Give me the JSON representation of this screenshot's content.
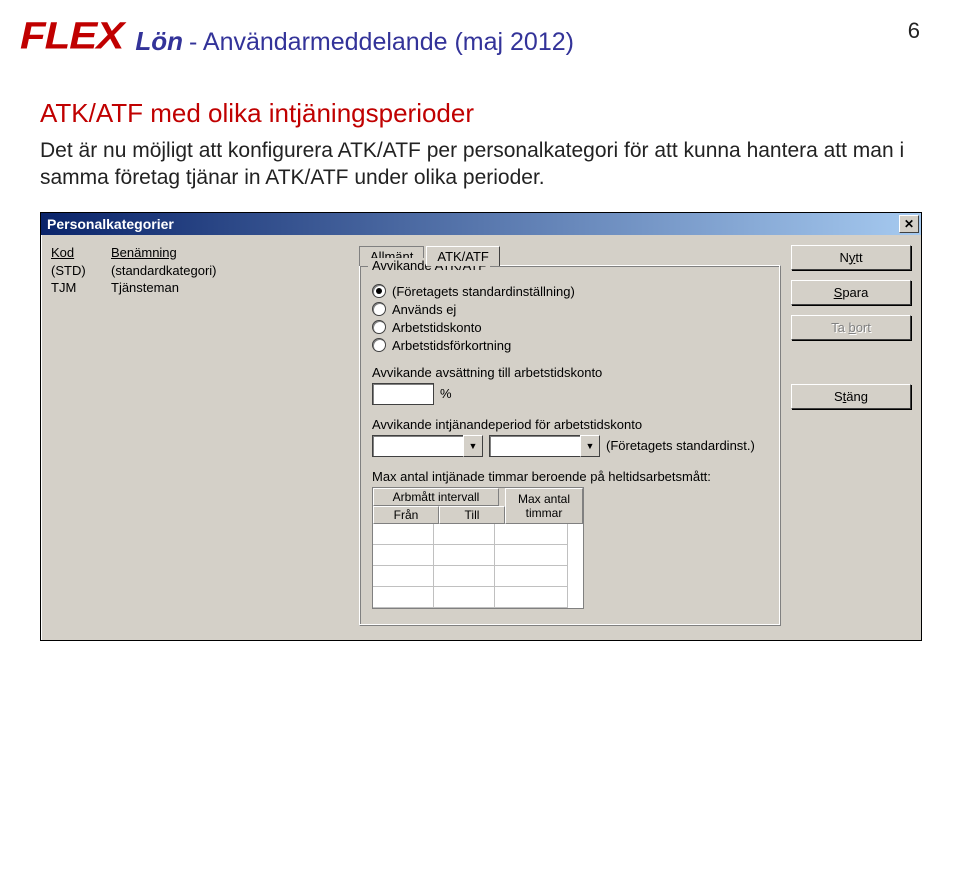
{
  "header": {
    "logo": "FLEX",
    "product": "Lön",
    "subtitle": "- Användarmeddelande (maj 2012)",
    "page_number": "6"
  },
  "section": {
    "heading": "ATK/ATF med olika intjäningsperioder",
    "body": "Det är nu möjligt att konfigurera ATK/ATF per personalkategori för att kunna hantera att man i samma företag tjänar in ATK/ATF under olika perioder."
  },
  "dialog": {
    "title": "Personalkategorier",
    "list": {
      "headers": {
        "kod": "Kod",
        "benamning": "Benämning"
      },
      "rows": [
        {
          "kod": "(STD)",
          "ben": "(standardkategori)"
        },
        {
          "kod": "TJM",
          "ben": "Tjänsteman"
        }
      ]
    },
    "tabs": {
      "allmant_pre": "A",
      "allmant_u": "l",
      "allmant_post": "lmänt",
      "atkatf": "ATK/ATF"
    },
    "group": {
      "title": "Avvikande ATK/ATF",
      "radios": {
        "std": "(Företagets standardinställning)",
        "off": "Används ej",
        "konto": "Arbetstidskonto",
        "fork": "Arbetstidsförkortning"
      },
      "avsattning_label": "Avvikande avsättning till arbetstidskonto",
      "percent_sign": "%",
      "period_label": "Avvikande intjänandeperiod för arbetstidskonto",
      "period_hint": "(Företagets standardinst.)",
      "max_label": "Max antal intjänade timmar beroende på heltidsarbetsmått:",
      "grid": {
        "interval": "Arbmått intervall",
        "fran": "Från",
        "till": "Till",
        "maxa": "Max antal",
        "maxb": "timmar"
      }
    },
    "buttons": {
      "nytt_pre": "N",
      "nytt_u": "y",
      "nytt_post": "tt",
      "spara_u": "S",
      "spara_post": "para",
      "tabort_pre": "Ta ",
      "tabort_u": "b",
      "tabort_post": "ort",
      "stang_pre": "S",
      "stang_u": "t",
      "stang_post": "äng"
    }
  }
}
